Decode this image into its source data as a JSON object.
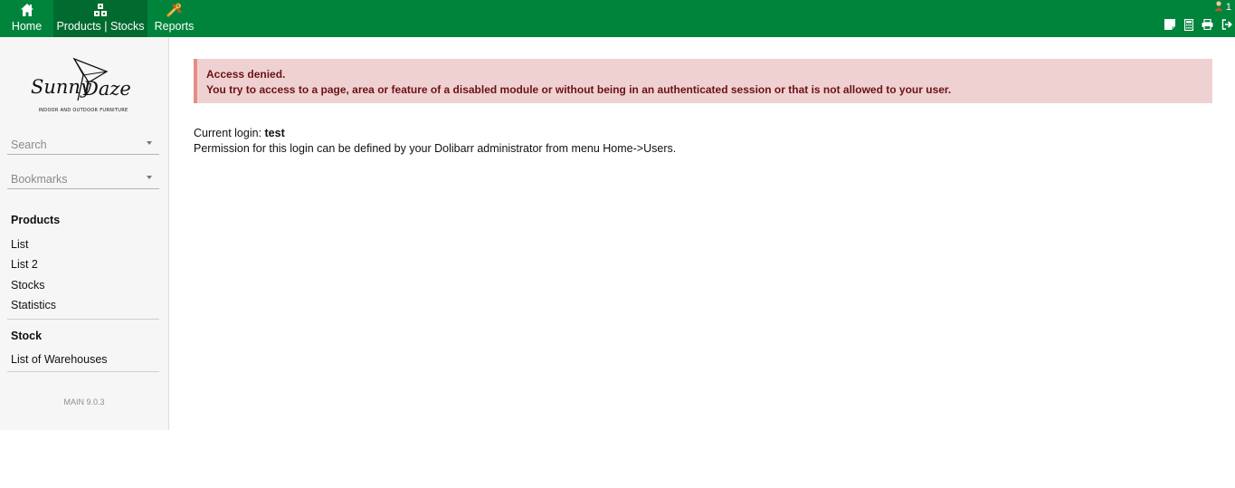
{
  "topnav": {
    "items": [
      {
        "label": "Home",
        "icon": "home-icon"
      },
      {
        "label": "Products | Stocks",
        "icon": "boxes-icon"
      },
      {
        "label": "Reports",
        "icon": "tools-icon"
      }
    ]
  },
  "topright": {
    "user_count": "1",
    "icons": [
      "user-icon",
      "notepad-icon",
      "calculator-icon",
      "print-icon",
      "logout-icon"
    ]
  },
  "sidebar": {
    "logo": {
      "brand": "SunnyDaze",
      "tagline": "INDOOR AND OUTDOOR FURNITURE"
    },
    "search_placeholder": "Search",
    "bookmarks_placeholder": "Bookmarks",
    "sections": [
      {
        "title": "Products",
        "links": [
          "List",
          "List 2",
          "Stocks",
          "Statistics"
        ]
      },
      {
        "title": "Stock",
        "links": [
          "List of Warehouses"
        ]
      }
    ],
    "version": "MAIN 9.0.3"
  },
  "main": {
    "alert": {
      "title": "Access denied.",
      "message": "You try to access to a page, area or feature of a disabled module or without being in an authenticated session or that is not allowed to your user."
    },
    "current_login_label": "Current login: ",
    "current_login_value": "test",
    "permission_text": "Permission for this login can be defined by your Dolibarr administrator from menu Home->Users."
  },
  "colors": {
    "topbar": "#00843c",
    "active_tab": "#006a2f",
    "alert_bg": "#f0d1d2",
    "alert_border": "#e48e86",
    "alert_text": "#6a1214"
  }
}
